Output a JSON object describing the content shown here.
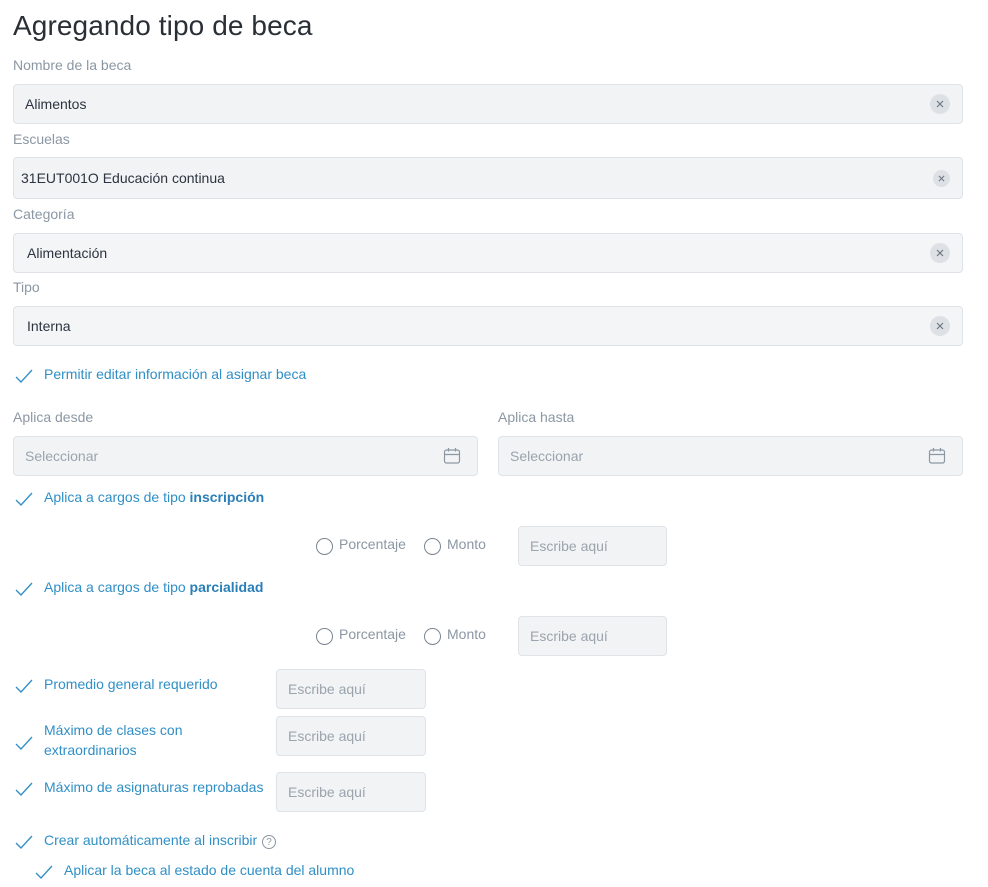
{
  "page": {
    "title": "Agregando tipo de beca"
  },
  "form": {
    "nombre": {
      "label": "Nombre de la beca",
      "value": "Alimentos"
    },
    "escuelas": {
      "label": "Escuelas",
      "value": "31EUT001O Educación continua"
    },
    "categoria": {
      "label": "Categoría",
      "value": "Alimentación"
    },
    "tipo": {
      "label": "Tipo",
      "value": "Interna"
    },
    "permitir_editar": {
      "label": "Permitir editar información al asignar beca"
    },
    "aplica_desde": {
      "label": "Aplica desde",
      "placeholder": "Seleccionar"
    },
    "aplica_hasta": {
      "label": "Aplica hasta",
      "placeholder": "Seleccionar"
    },
    "inscripcion": {
      "prefix": "Aplica a cargos de tipo ",
      "bold": "inscripción",
      "opt_porcentaje": "Porcentaje",
      "opt_monto": "Monto",
      "placeholder": "Escribe aquí"
    },
    "parcialidad": {
      "prefix": "Aplica a cargos de tipo ",
      "bold": "parcialidad",
      "opt_porcentaje": "Porcentaje",
      "opt_monto": "Monto",
      "placeholder": "Escribe aquí"
    },
    "promedio": {
      "label": "Promedio general requerido",
      "placeholder": "Escribe aquí"
    },
    "max_extra": {
      "label_line1": "Máximo de clases con",
      "label_line2": "extraordinarios",
      "placeholder": "Escribe aquí"
    },
    "max_reprobadas": {
      "label": "Máximo de asignaturas reprobadas",
      "placeholder": "Escribe aquí"
    },
    "crear_auto": {
      "label": "Crear automáticamente al inscribir",
      "help": "?"
    },
    "aplicar_estado": {
      "label": "Aplicar la beca al estado de cuenta del alumno"
    }
  },
  "icons": {
    "check": "check-icon",
    "clear": "close-icon",
    "calendar": "calendar-icon",
    "help": "help-icon"
  },
  "colors": {
    "accent": "#2f8fc6",
    "field_bg": "#f2f3f5",
    "label": "#8b97a3"
  }
}
